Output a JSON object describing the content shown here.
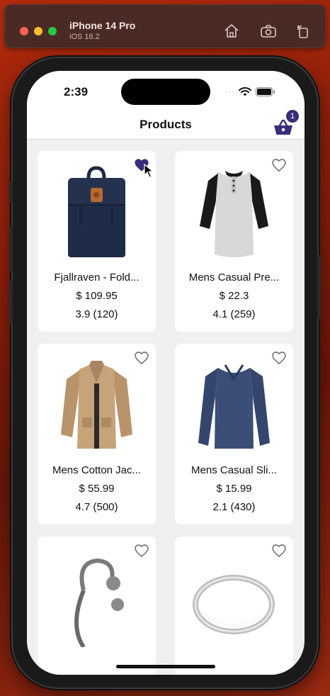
{
  "simulator": {
    "device_name": "iPhone 14 Pro",
    "os_version": "iOS 16.2",
    "tools": [
      "home-icon",
      "screenshot-icon",
      "rotate-icon"
    ]
  },
  "status_bar": {
    "time": "2:39",
    "signal": "···",
    "icons": [
      "wifi-icon",
      "battery-icon"
    ]
  },
  "nav": {
    "title": "Products",
    "cart_icon": "basket-icon",
    "cart_badge": "1"
  },
  "colors": {
    "accent": "#3b2d7a",
    "favorite_outline": "#777777",
    "card_bg": "#ffffff",
    "screen_bg": "#f0f0f0"
  },
  "products": [
    {
      "title": "Fjallraven - Fold...",
      "price": "$ 109.95",
      "rating": "3.9 (120)",
      "favorite": true,
      "image": "backpack"
    },
    {
      "title": "Mens Casual Pre...",
      "price": "$ 22.3",
      "rating": "4.1 (259)",
      "favorite": false,
      "image": "raglan-shirt"
    },
    {
      "title": "Mens Cotton Jac...",
      "price": "$ 55.99",
      "rating": "4.7 (500)",
      "favorite": false,
      "image": "jacket"
    },
    {
      "title": "Mens Casual Sli...",
      "price": "$ 15.99",
      "rating": "2.1 (430)",
      "favorite": false,
      "image": "long-sleeve-shirt"
    },
    {
      "title": "",
      "price": "",
      "rating": "",
      "favorite": false,
      "image": "bracelet"
    },
    {
      "title": "",
      "price": "",
      "rating": "",
      "favorite": false,
      "image": "ring"
    }
  ]
}
